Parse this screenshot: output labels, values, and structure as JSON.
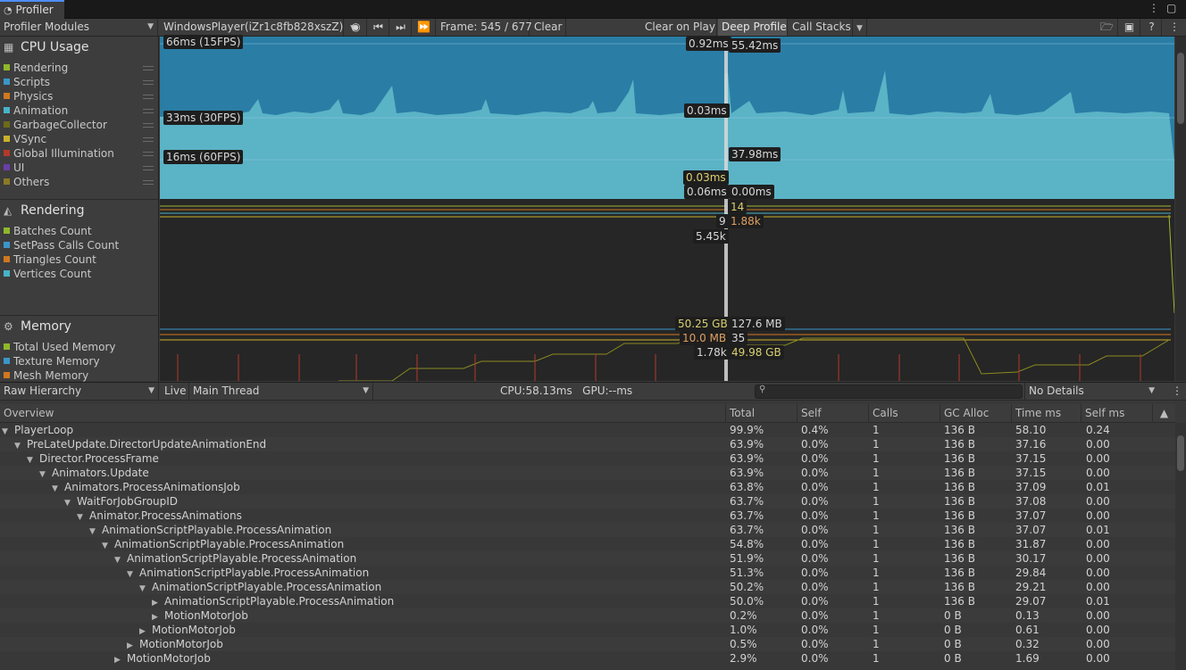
{
  "window": {
    "title": "Profiler"
  },
  "toolbar": {
    "modules_label": "Profiler Modules",
    "target_label": "WindowsPlayer(iZr1c8fb828xszZ)",
    "frame_label": "Frame: 545 / 677",
    "clear": "Clear",
    "clear_on_play": "Clear on Play",
    "deep_profile": "Deep Profile",
    "call_stacks": "Call Stacks"
  },
  "modules": {
    "cpu": {
      "title": "CPU Usage",
      "legend": [
        {
          "label": "Rendering",
          "color": "#8fb72a"
        },
        {
          "label": "Scripts",
          "color": "#3a96c8"
        },
        {
          "label": "Physics",
          "color": "#d0781f"
        },
        {
          "label": "Animation",
          "color": "#48b3c8"
        },
        {
          "label": "GarbageCollector",
          "color": "#6d6a1c"
        },
        {
          "label": "VSync",
          "color": "#c9b12a"
        },
        {
          "label": "Global Illumination",
          "color": "#b23a2a"
        },
        {
          "label": "UI",
          "color": "#6a3ea8"
        },
        {
          "label": "Others",
          "color": "#8a7a24"
        }
      ],
      "guides": [
        "66ms (15FPS)",
        "33ms (30FPS)",
        "16ms (60FPS)"
      ],
      "values": [
        "0.92ms",
        "55.42ms",
        "0.03ms",
        "37.98ms",
        "0.03ms",
        "0.06ms",
        "0.00ms"
      ]
    },
    "rendering": {
      "title": "Rendering",
      "legend": [
        {
          "label": "Batches Count",
          "color": "#8fb72a"
        },
        {
          "label": "SetPass Calls Count",
          "color": "#3a96c8"
        },
        {
          "label": "Triangles Count",
          "color": "#d0781f"
        },
        {
          "label": "Vertices Count",
          "color": "#48b3c8"
        }
      ],
      "values": [
        "14",
        "9",
        "1.88k",
        "5.45k"
      ]
    },
    "memory": {
      "title": "Memory",
      "legend": [
        {
          "label": "Total Used Memory",
          "color": "#8fb72a"
        },
        {
          "label": "Texture Memory",
          "color": "#3a96c8"
        },
        {
          "label": "Mesh Memory",
          "color": "#d0781f"
        }
      ],
      "values": [
        "50.25 GB",
        "127.6 MB",
        "10.0 MB",
        "35",
        "1.78k",
        "49.98 GB"
      ]
    }
  },
  "details": {
    "view": "Raw Hierarchy",
    "live": "Live",
    "thread": "Main Thread",
    "cpu_gpu": "CPU:58.13ms   GPU:--ms",
    "search_placeholder": "",
    "details_mode": "No Details"
  },
  "table": {
    "columns": [
      "Overview",
      "Total",
      "Self",
      "Calls",
      "GC Alloc",
      "Time ms",
      "Self ms"
    ],
    "rows": [
      {
        "name": "PlayerLoop",
        "depth": 0,
        "expander": "open",
        "total": "99.9%",
        "self": "0.4%",
        "calls": "1",
        "gc": "136 B",
        "time": "58.10",
        "selfms": "0.24"
      },
      {
        "name": "PreLateUpdate.DirectorUpdateAnimationEnd",
        "depth": 1,
        "expander": "open",
        "total": "63.9%",
        "self": "0.0%",
        "calls": "1",
        "gc": "136 B",
        "time": "37.16",
        "selfms": "0.00"
      },
      {
        "name": "Director.ProcessFrame",
        "depth": 2,
        "expander": "open",
        "total": "63.9%",
        "self": "0.0%",
        "calls": "1",
        "gc": "136 B",
        "time": "37.15",
        "selfms": "0.00"
      },
      {
        "name": "Animators.Update",
        "depth": 3,
        "expander": "open",
        "total": "63.9%",
        "self": "0.0%",
        "calls": "1",
        "gc": "136 B",
        "time": "37.15",
        "selfms": "0.00"
      },
      {
        "name": "Animators.ProcessAnimationsJob",
        "depth": 4,
        "expander": "open",
        "total": "63.8%",
        "self": "0.0%",
        "calls": "1",
        "gc": "136 B",
        "time": "37.09",
        "selfms": "0.01"
      },
      {
        "name": "WaitForJobGroupID",
        "depth": 5,
        "expander": "open",
        "total": "63.7%",
        "self": "0.0%",
        "calls": "1",
        "gc": "136 B",
        "time": "37.08",
        "selfms": "0.00"
      },
      {
        "name": "Animator.ProcessAnimations",
        "depth": 6,
        "expander": "open",
        "total": "63.7%",
        "self": "0.0%",
        "calls": "1",
        "gc": "136 B",
        "time": "37.07",
        "selfms": "0.00"
      },
      {
        "name": "AnimationScriptPlayable.ProcessAnimation",
        "depth": 7,
        "expander": "open",
        "total": "63.7%",
        "self": "0.0%",
        "calls": "1",
        "gc": "136 B",
        "time": "37.07",
        "selfms": "0.01"
      },
      {
        "name": "AnimationScriptPlayable.ProcessAnimation",
        "depth": 8,
        "expander": "open",
        "total": "54.8%",
        "self": "0.0%",
        "calls": "1",
        "gc": "136 B",
        "time": "31.87",
        "selfms": "0.00"
      },
      {
        "name": "AnimationScriptPlayable.ProcessAnimation",
        "depth": 9,
        "expander": "open",
        "total": "51.9%",
        "self": "0.0%",
        "calls": "1",
        "gc": "136 B",
        "time": "30.17",
        "selfms": "0.00"
      },
      {
        "name": "AnimationScriptPlayable.ProcessAnimation",
        "depth": 10,
        "expander": "open",
        "total": "51.3%",
        "self": "0.0%",
        "calls": "1",
        "gc": "136 B",
        "time": "29.84",
        "selfms": "0.00"
      },
      {
        "name": "AnimationScriptPlayable.ProcessAnimation",
        "depth": 11,
        "expander": "open",
        "total": "50.2%",
        "self": "0.0%",
        "calls": "1",
        "gc": "136 B",
        "time": "29.21",
        "selfms": "0.00"
      },
      {
        "name": "AnimationScriptPlayable.ProcessAnimation",
        "depth": 12,
        "expander": "closed",
        "total": "50.0%",
        "self": "0.0%",
        "calls": "1",
        "gc": "136 B",
        "time": "29.07",
        "selfms": "0.01"
      },
      {
        "name": "MotionMotorJob",
        "depth": 12,
        "expander": "closed",
        "total": "0.2%",
        "self": "0.0%",
        "calls": "1",
        "gc": "0 B",
        "time": "0.13",
        "selfms": "0.00"
      },
      {
        "name": "MotionMotorJob",
        "depth": 11,
        "expander": "closed",
        "total": "1.0%",
        "self": "0.0%",
        "calls": "1",
        "gc": "0 B",
        "time": "0.61",
        "selfms": "0.00"
      },
      {
        "name": "MotionMotorJob",
        "depth": 10,
        "expander": "closed",
        "total": "0.5%",
        "self": "0.0%",
        "calls": "1",
        "gc": "0 B",
        "time": "0.32",
        "selfms": "0.00"
      },
      {
        "name": "MotionMotorJob",
        "depth": 9,
        "expander": "closed",
        "total": "2.9%",
        "self": "0.0%",
        "calls": "1",
        "gc": "0 B",
        "time": "1.69",
        "selfms": "0.00"
      }
    ]
  }
}
